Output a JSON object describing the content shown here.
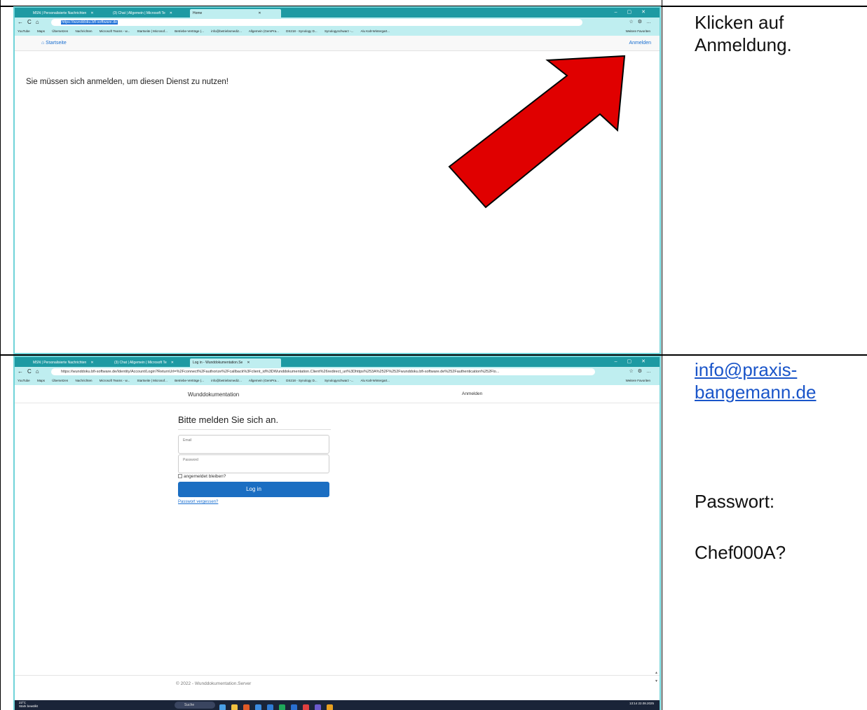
{
  "row1": {
    "browser": {
      "tabs": [
        "MSN | Personalisierte Nachrichten",
        "(3) Chat | Allgemein | Microsoft Te",
        "Home"
      ],
      "url": "https://wunddoku.bfi-software.de",
      "bookmarks": [
        "YouTube",
        "Maps",
        "Übersetzen",
        "Nachrichten",
        "Microsoft Teams - w...",
        "Startseite | Microsof...",
        "Betriebe-Verträge (...",
        "info@betriebsmediz...",
        "Allgemein (GemPra...",
        "DS218 - Synology D...",
        "Synologyschwarz -...",
        "Alu Kalt-Wintergart..."
      ],
      "bookmarks_more": "Weitere Favoriten"
    },
    "app": {
      "home_link": "⌂ Startseite",
      "login_link": "Anmelden",
      "message": "Sie müssen sich anmelden, um diesen Dienst zu nutzen!"
    },
    "arrow_color": "#e00000",
    "note_lines": [
      "Klicken auf",
      "Anmeldung."
    ]
  },
  "row2": {
    "browser": {
      "tabs": [
        "MSN | Personalisierte Nachrichten",
        "(3) Chat | Allgemein | Microsoft Te",
        "Log in - Wunddokumentation.Se"
      ],
      "url": "https://wunddoku.bfi-software.de/Identity/Account/Login?ReturnUrl=%2Fconnect%2Fauthorize%2Fcallback%3Fclient_id%3DWunddokumentation.Client%26redirect_uri%3Dhttps%253A%252F%252Fwunddoku.bfi-software.de%252Fauthentication%252Flo...",
      "bookmarks": [
        "YouTube",
        "Maps",
        "Übersetzen",
        "Nachrichten",
        "Microsoft Teams - w...",
        "Startseite | Microsof...",
        "Betriebe-Verträge (...",
        "info@betriebsmediz...",
        "Allgemein (GemPra...",
        "DS218 - Synology D...",
        "Synologyschwarz -...",
        "Alu Kalt-Wintergart..."
      ],
      "bookmarks_more": "Weitere Favoriten"
    },
    "app": {
      "brand": "Wunddokumentation",
      "login_link": "Anmelden",
      "heading": "Bitte melden Sie sich an.",
      "email_placeholder": "Email",
      "password_placeholder": "Password",
      "remember_label": "angemeldet bleiben?",
      "login_button": "Log in",
      "forgot_link": "Passwort vergessen?",
      "footer": "© 2022 - Wunddokumentation.Server"
    },
    "taskbar": {
      "weather": "23°C",
      "weather_sub": "Stark bewölkt",
      "search": "Suche",
      "time": "13:14",
      "date": "22.08.2025"
    },
    "note_email_1": "info@praxis-",
    "note_email_2": "bangemann.de",
    "note_pw_label": "Passwort:",
    "note_pw_value": "Chef000A?"
  }
}
